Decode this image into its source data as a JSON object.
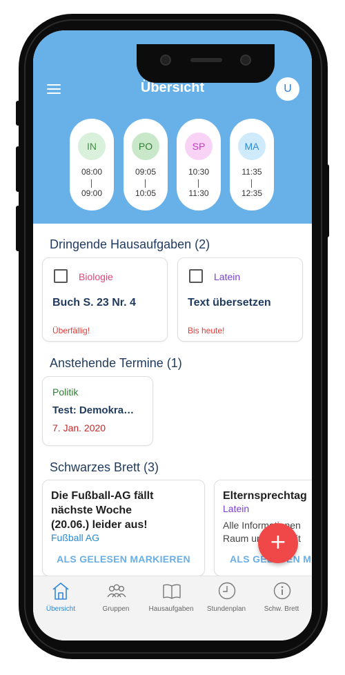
{
  "header": {
    "title": "Übersicht",
    "avatar_initial": "U"
  },
  "lessons": [
    {
      "code": "IN",
      "start": "08:00",
      "end": "09:00",
      "bg": "#d9f1db",
      "fg": "#3f8f46"
    },
    {
      "code": "PO",
      "start": "09:05",
      "end": "10:05",
      "bg": "#c9e8c9",
      "fg": "#2e7d32"
    },
    {
      "code": "SP",
      "start": "10:30",
      "end": "11:30",
      "bg": "#f8d3f6",
      "fg": "#c33cc0"
    },
    {
      "code": "MA",
      "start": "11:35",
      "end": "12:35",
      "bg": "#cfeafb",
      "fg": "#2a8ad0"
    }
  ],
  "homework": {
    "title": "Dringende Hausaufgaben (2)",
    "items": [
      {
        "subject": "Biologie",
        "subject_color": "#e0457b",
        "task": "Buch S. 23 Nr. 4",
        "due": "Überfällig!"
      },
      {
        "subject": "Latein",
        "subject_color": "#7b3fd1",
        "task": "Text übersetzen",
        "due": "Bis heute!"
      }
    ]
  },
  "events": {
    "title": "Anstehende Termine (1)",
    "items": [
      {
        "subject": "Politik",
        "subject_color": "#2e7d32",
        "name": "Test: Demokra…",
        "date": "7. Jan. 2020"
      }
    ]
  },
  "board": {
    "title": "Schwarzes Brett (3)",
    "items": [
      {
        "line1": "Die Fußball-AG fällt",
        "line2": "nächste Woche",
        "line3": "(20.06.) leider aus!",
        "group": "Fußball AG",
        "group_color": "#2a8ad0",
        "action": "ALS GELESEN MARKIEREN"
      },
      {
        "line1": "Elternsprechtag",
        "group": "Latein",
        "group_color": "#7b3fd1",
        "body1": "Alle Informationen",
        "body2": "Raum und Uhrzeit",
        "action": "ALS GELESEN MARKIEREN"
      }
    ]
  },
  "fab": {
    "label": "+"
  },
  "nav": {
    "items": [
      {
        "label": "Übersicht",
        "icon": "home-icon"
      },
      {
        "label": "Gruppen",
        "icon": "groups-icon"
      },
      {
        "label": "Hausaufgaben",
        "icon": "book-icon"
      },
      {
        "label": "Stundenplan",
        "icon": "clock-icon"
      },
      {
        "label": "Schw. Brett",
        "icon": "info-icon"
      }
    ]
  },
  "colors": {
    "header_bg": "#68b0e8",
    "accent": "#2f86d6",
    "fab_bg": "#f04848"
  }
}
